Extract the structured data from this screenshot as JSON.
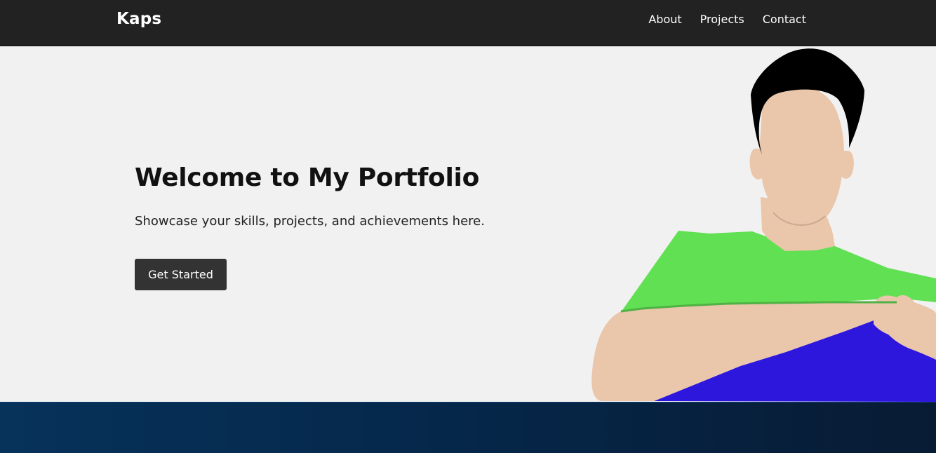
{
  "navbar": {
    "brand": "Kaps",
    "links": [
      {
        "label": "About"
      },
      {
        "label": "Projects"
      },
      {
        "label": "Contact"
      }
    ]
  },
  "hero": {
    "title": "Welcome to My Portfolio",
    "subtitle": "Showcase your skills, projects, and achievements here.",
    "button_label": "Get Started"
  },
  "colors": {
    "navbar_background": "#222222",
    "hero_background": "#f1f1f1",
    "button_background": "#333333",
    "shirt_green": "#61e053",
    "skin": "#eac6aa",
    "hair": "#000000",
    "pants_blue": "#2e17dd",
    "footer_background": "#05284b"
  },
  "icons": {
    "hero_illustration": "person-illustration"
  }
}
